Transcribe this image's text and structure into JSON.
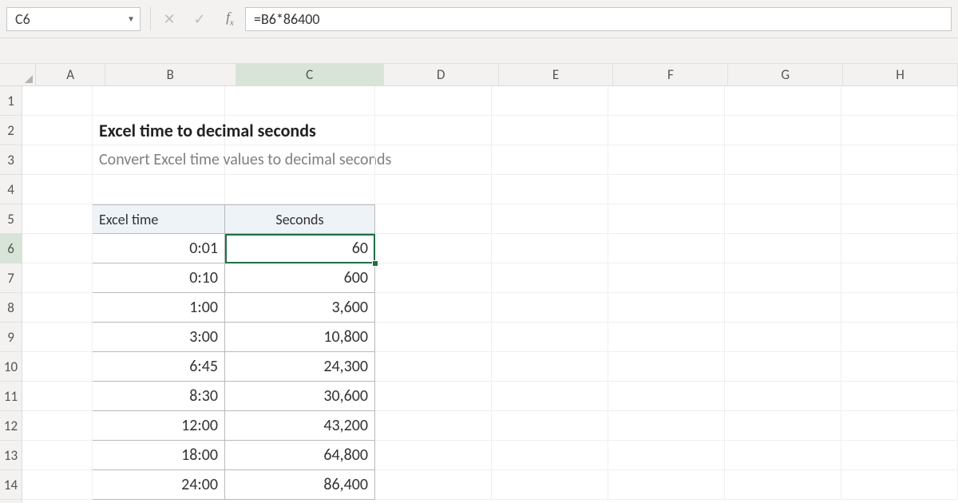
{
  "namebox": {
    "cell_ref": "C6"
  },
  "formula_bar": {
    "cancel_tooltip": "Cancel",
    "enter_tooltip": "Enter",
    "fx_tooltip": "Insert Function",
    "formula": "=B6*86400"
  },
  "columns": [
    "A",
    "B",
    "C",
    "D",
    "E",
    "F",
    "G",
    "H"
  ],
  "rows": [
    "1",
    "2",
    "3",
    "4",
    "5",
    "6",
    "7",
    "8",
    "9",
    "10",
    "11",
    "12",
    "13",
    "14"
  ],
  "active": {
    "col": "C",
    "row": "6"
  },
  "content": {
    "title": "Excel time to decimal seconds",
    "subtitle": "Convert Excel time values to decimal seconds"
  },
  "table": {
    "headers": {
      "col_b": "Excel time",
      "col_c": "Seconds"
    },
    "rows": [
      {
        "time": "0:01",
        "seconds": "60"
      },
      {
        "time": "0:10",
        "seconds": "600"
      },
      {
        "time": "1:00",
        "seconds": "3,600"
      },
      {
        "time": "3:00",
        "seconds": "10,800"
      },
      {
        "time": "6:45",
        "seconds": "24,300"
      },
      {
        "time": "8:30",
        "seconds": "30,600"
      },
      {
        "time": "12:00",
        "seconds": "43,200"
      },
      {
        "time": "18:00",
        "seconds": "64,800"
      },
      {
        "time": "24:00",
        "seconds": "86,400"
      }
    ]
  },
  "chart_data": {
    "type": "table",
    "title": "Excel time to decimal seconds",
    "columns": [
      "Excel time",
      "Seconds"
    ],
    "rows": [
      [
        "0:01",
        60
      ],
      [
        "0:10",
        600
      ],
      [
        "1:00",
        3600
      ],
      [
        "3:00",
        10800
      ],
      [
        "6:45",
        24300
      ],
      [
        "8:30",
        30600
      ],
      [
        "12:00",
        43200
      ],
      [
        "18:00",
        64800
      ],
      [
        "24:00",
        86400
      ]
    ]
  }
}
